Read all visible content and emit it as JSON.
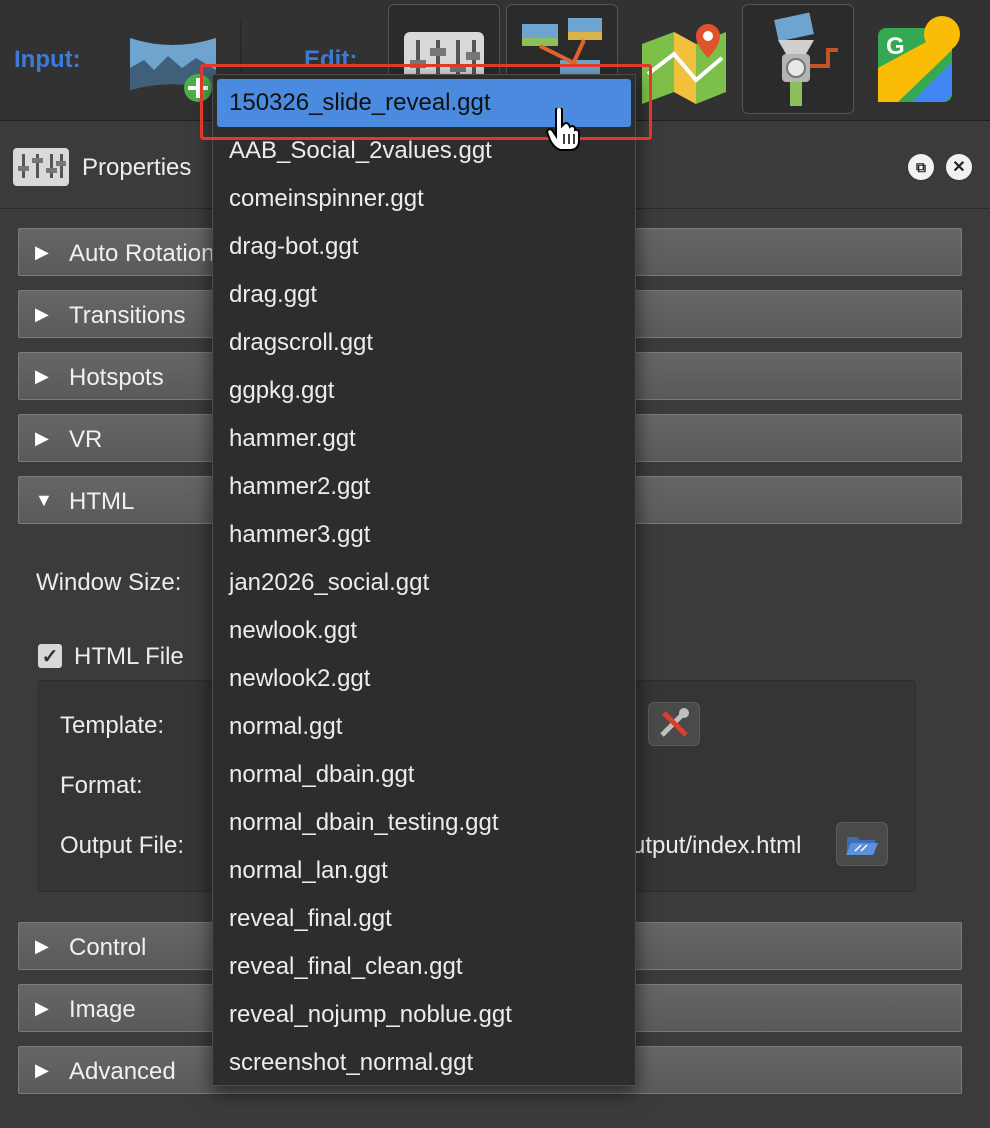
{
  "toolbar": {
    "input_label": "Input:",
    "edit_label": "Edit:",
    "icons": [
      "panorama-add-icon",
      "properties-sliders-icon",
      "tour-browser-icon",
      "map-icon",
      "grinder-icon",
      "google-maps-icon"
    ]
  },
  "properties": {
    "title": "Properties",
    "sections_top": [
      {
        "label": "Auto Rotation",
        "expanded": false
      },
      {
        "label": "Transitions",
        "expanded": false
      },
      {
        "label": "Hotspots",
        "expanded": false
      },
      {
        "label": "VR",
        "expanded": false
      },
      {
        "label": "HTML",
        "expanded": true
      }
    ],
    "window_size_label": "Window Size:",
    "html_file_label": "HTML File",
    "html_file_checked": true,
    "template_label": "Template:",
    "format_label": "Format:",
    "output_file_label": "Output File:",
    "output_file_value": "utput/index.html",
    "sections_bottom": [
      {
        "label": "Control",
        "expanded": false
      },
      {
        "label": "Image",
        "expanded": false
      },
      {
        "label": "Advanced",
        "expanded": false
      }
    ]
  },
  "dropdown": {
    "selected_index": 0,
    "items": [
      "150326_slide_reveal.ggt",
      "AAB_Social_2values.ggt",
      "comeinspinner.ggt",
      "drag-bot.ggt",
      "drag.ggt",
      "dragscroll.ggt",
      "ggpkg.ggt",
      "hammer.ggt",
      "hammer2.ggt",
      "hammer3.ggt",
      "jan2026_social.ggt",
      "newlook.ggt",
      "newlook2.ggt",
      "normal.ggt",
      "normal_dbain.ggt",
      "normal_dbain_testing.ggt",
      "normal_lan.ggt",
      "reveal_final.ggt",
      "reveal_final_clean.ggt",
      "reveal_nojump_noblue.ggt",
      "screenshot_normal.ggt"
    ]
  },
  "colors": {
    "accent_blue": "#3d7bd6",
    "selection": "#4a8be0",
    "annotation_red": "#e0392b"
  }
}
